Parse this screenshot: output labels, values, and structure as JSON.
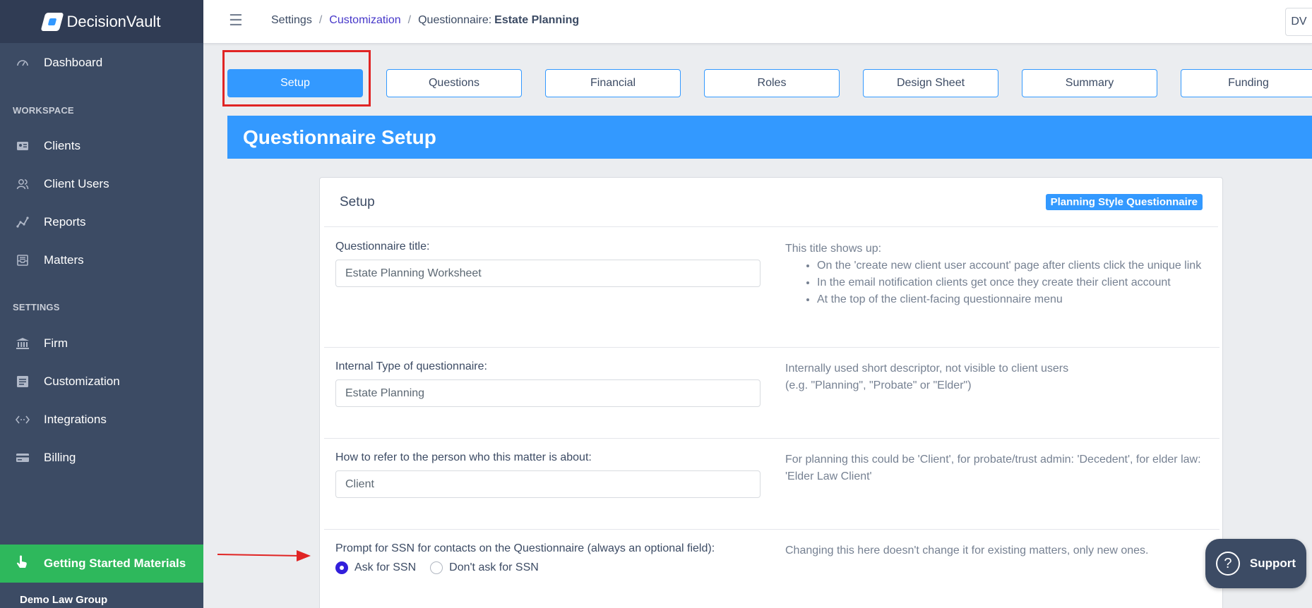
{
  "app": {
    "name": "DecisionVault"
  },
  "sidebar": {
    "dashboard": "Dashboard",
    "workspace_title": "WORKSPACE",
    "workspace_items": [
      {
        "label": "Clients",
        "icon": "id-card-icon"
      },
      {
        "label": "Client Users",
        "icon": "users-icon"
      },
      {
        "label": "Reports",
        "icon": "chart-line-icon"
      },
      {
        "label": "Matters",
        "icon": "inbox-icon"
      }
    ],
    "settings_title": "SETTINGS",
    "settings_items": [
      {
        "label": "Firm",
        "icon": "bank-icon"
      },
      {
        "label": "Customization",
        "icon": "list-icon"
      },
      {
        "label": "Integrations",
        "icon": "code-icon"
      },
      {
        "label": "Billing",
        "icon": "credit-card-icon"
      }
    ],
    "getting_started": "Getting Started Materials",
    "firm_name": "Demo Law Group"
  },
  "header": {
    "breadcrumb": {
      "settings": "Settings",
      "customization": "Customization",
      "questionnaire_prefix": "Questionnaire:",
      "questionnaire_name": "Estate Planning"
    },
    "user_initials": "DV"
  },
  "tabs": [
    "Setup",
    "Questions",
    "Financial",
    "Roles",
    "Design Sheet",
    "Summary",
    "Funding"
  ],
  "active_tab": "Setup",
  "banner_title": "Questionnaire Setup",
  "card": {
    "title": "Setup",
    "badge": "Planning Style Questionnaire",
    "rows": {
      "title_field": {
        "label": "Questionnaire title:",
        "value": "Estate Planning Worksheet",
        "help_intro": "This title shows up:",
        "help_items": [
          "On the 'create new client user account' page after clients click the unique link",
          "In the email notification clients get once they create their client account",
          "At the top of the client-facing questionnaire menu"
        ]
      },
      "type_field": {
        "label": "Internal Type of questionnaire:",
        "value": "Estate Planning",
        "help_line1": "Internally used short descriptor, not visible to client users",
        "help_line2": "(e.g. \"Planning\", \"Probate\" or \"Elder\")"
      },
      "person_field": {
        "label": "How to refer to the person who this matter is about:",
        "value": "Client",
        "help": "For planning this could be 'Client', for probate/trust admin: 'Decedent', for elder law: 'Elder Law Client'"
      },
      "ssn_field": {
        "label": "Prompt for SSN for contacts on the Questionnaire (always an optional field):",
        "options": [
          "Ask for SSN",
          "Don't ask for SSN"
        ],
        "selected": "Ask for SSN",
        "help": "Changing this here doesn't change it for existing matters, only new ones."
      }
    }
  },
  "support": {
    "label": "Support"
  },
  "colors": {
    "primary": "#3399ff",
    "sidebar": "#3c4b64",
    "success": "#2eb85c",
    "annotation": "#e02424"
  }
}
